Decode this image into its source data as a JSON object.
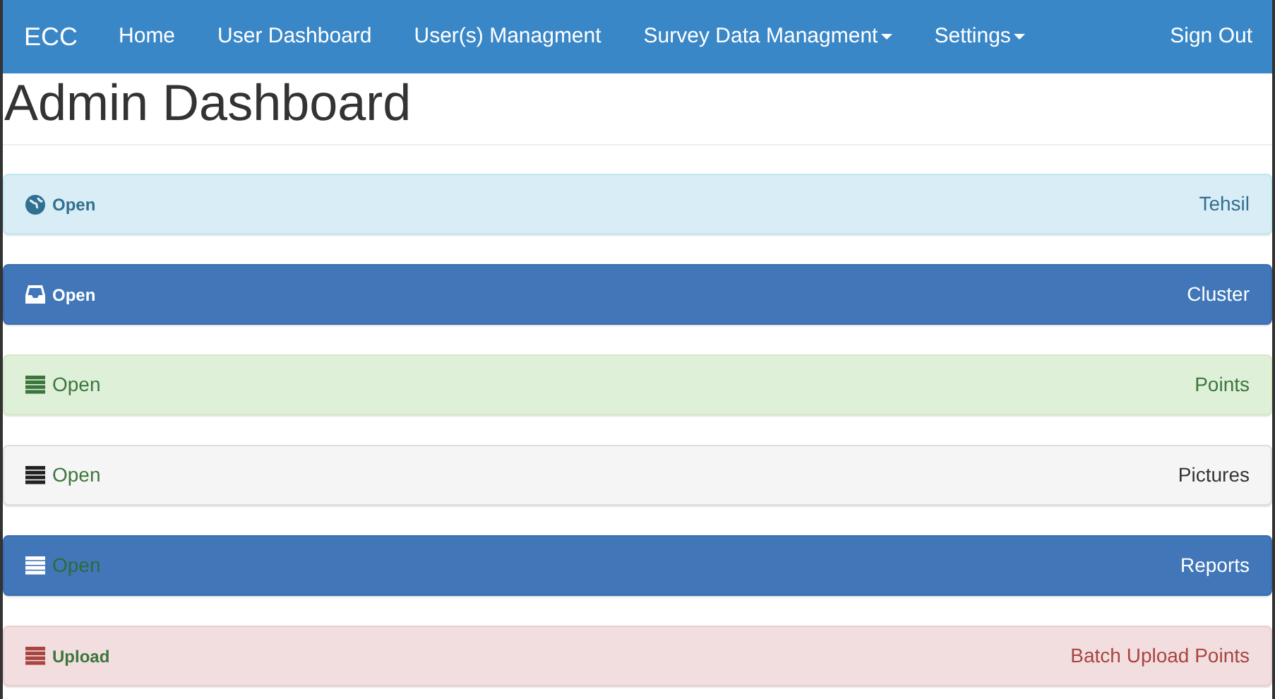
{
  "navbar": {
    "brand": "ECC",
    "items": [
      {
        "label": "Home",
        "dropdown": false
      },
      {
        "label": "User Dashboard",
        "dropdown": false
      },
      {
        "label": "User(s) Managment",
        "dropdown": false
      },
      {
        "label": "Survey Data Managment",
        "dropdown": true
      },
      {
        "label": "Settings",
        "dropdown": true
      }
    ],
    "right": "Sign Out"
  },
  "heading": "Admin Dashboard",
  "panels": [
    {
      "kind": "info",
      "link": "Open",
      "title": "Tehsil"
    },
    {
      "kind": "primary",
      "link": "Open",
      "title": "Cluster"
    },
    {
      "kind": "success",
      "link": "Open",
      "title": "Points"
    },
    {
      "kind": "default",
      "link": "Open",
      "title": "Pictures"
    },
    {
      "kind": "reports",
      "link": "Open",
      "title": "Reports"
    },
    {
      "kind": "danger",
      "link": "Upload",
      "title": "Batch Upload Points"
    }
  ]
}
